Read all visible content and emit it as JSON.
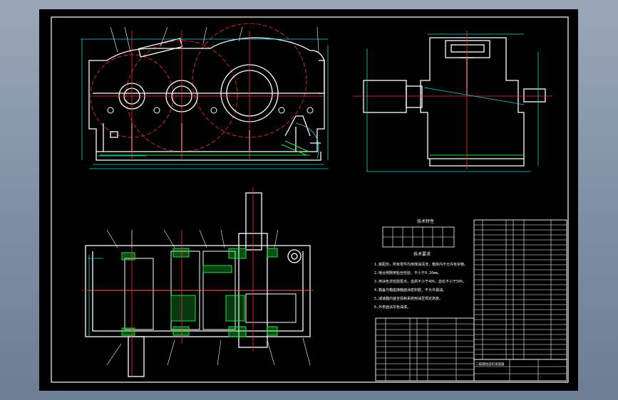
{
  "drawing": {
    "title_block_text": "二级圆柱齿轮减速器",
    "tech_chars_title": "技术特性",
    "tech_reqs_title": "技术要求",
    "tech_reqs_lines": [
      "1.装配前，所有零件均用煤油清洗，箱体内不允许有杂物。",
      "2.啮合侧隙用铅丝检验，不小于0.16mm。",
      "3.用涂色法检验斑点，齿高不小于40%，齿长不小于50%。",
      "4.箱盖与箱座接触面涂密封胶，不允许漏油。",
      "5.减速器内装全损耗系统用油至规定高度。",
      "6.外表面涂灰色油漆。"
    ]
  },
  "colors": {
    "background": "#000000",
    "outline": "#ffffff",
    "centerline": "#ff3030",
    "dimension": "#22d0e0",
    "hatch": "#20e040",
    "frame": "#ffffff"
  }
}
